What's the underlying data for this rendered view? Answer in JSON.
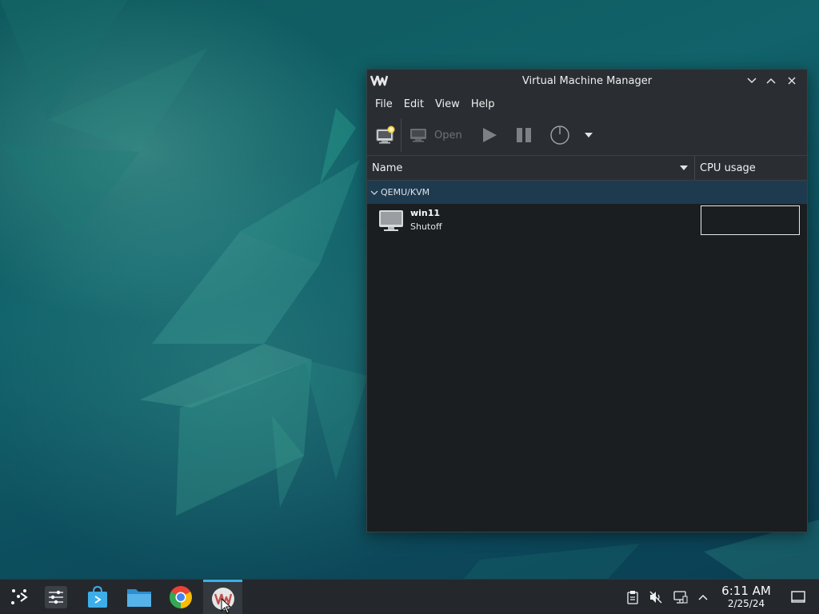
{
  "window": {
    "title": "Virtual Machine Manager",
    "logo_text": "VM"
  },
  "menu": [
    "File",
    "Edit",
    "View",
    "Help"
  ],
  "toolbar": {
    "open_label": "Open",
    "icons": [
      "new-vm-icon",
      "monitor-icon",
      "play-icon",
      "pause-icon",
      "power-icon",
      "dropdown-arrow-icon"
    ]
  },
  "columns": {
    "name": "Name",
    "cpu": "CPU usage"
  },
  "group": {
    "label": "QEMU/KVM"
  },
  "vm": {
    "name": "win11",
    "status": "Shutoff"
  },
  "tray": {
    "time": "6:11 AM",
    "date": "2/25/24"
  },
  "colors": {
    "accent": "#3daee9",
    "window_bg": "#1b1e20",
    "chrome_bg": "#2a2e32",
    "group_row": "#1e3a4f",
    "taskbar": "#24282c"
  }
}
